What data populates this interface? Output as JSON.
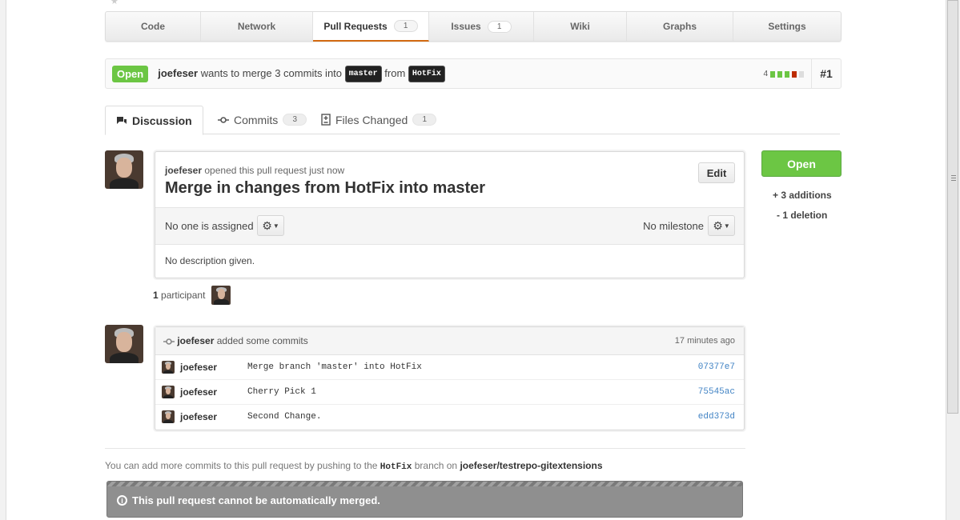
{
  "repo_nav": {
    "items": [
      {
        "label": "Code"
      },
      {
        "label": "Network"
      },
      {
        "label": "Pull Requests",
        "count": "1"
      },
      {
        "label": "Issues",
        "count": "1"
      },
      {
        "label": "Wiki"
      },
      {
        "label": "Graphs"
      },
      {
        "label": "Settings"
      }
    ]
  },
  "pr_header": {
    "state": "Open",
    "author": "joefeser",
    "text_1": "wants to merge 3 commits into",
    "base_branch": "master",
    "text_2": "from",
    "head_branch": "HotFix",
    "diffstat_count": "4",
    "number": "#1"
  },
  "tabs": {
    "discussion": "Discussion",
    "commits": "Commits",
    "commits_count": "3",
    "files": "Files Changed",
    "files_count": "1"
  },
  "discussion": {
    "author": "joefeser",
    "opened_text": "opened this pull request just now",
    "title": "Merge in changes from HotFix into master",
    "edit_label": "Edit",
    "assignee_text": "No one is assigned",
    "milestone_text": "No milestone",
    "description": "No description given."
  },
  "participants": {
    "count": "1",
    "label": "participant"
  },
  "commits_box": {
    "author": "joefeser",
    "action": "added some commits",
    "time": "17 minutes ago",
    "rows": [
      {
        "author": "joefeser",
        "message": "Merge branch 'master' into HotFix",
        "sha": "07377e7"
      },
      {
        "author": "joefeser",
        "message": "Cherry Pick 1",
        "sha": "75545ac"
      },
      {
        "author": "joefeser",
        "message": "Second Change.",
        "sha": "edd373d"
      }
    ]
  },
  "sidebar": {
    "open_button": "Open",
    "additions": "+ 3 additions",
    "deletions": "- 1 deletion"
  },
  "hint": {
    "prefix": "You can add more commits to this pull request by pushing to the",
    "branch": "HotFix",
    "middle": "branch on",
    "repo": "joefeser/testrepo-gitextensions"
  },
  "merge_status": {
    "message": "This pull request cannot be automatically merged."
  },
  "colors": {
    "open_green": "#6cc644",
    "nav_selected": "#d26911",
    "link_blue": "#4183c4",
    "merge_gray": "#8f8f8f"
  },
  "icons": {
    "discussion": "speech-bubbles-icon",
    "commits": "commit-icon",
    "files": "file-diff-icon",
    "gear": "gear-icon",
    "info": "info-icon"
  }
}
